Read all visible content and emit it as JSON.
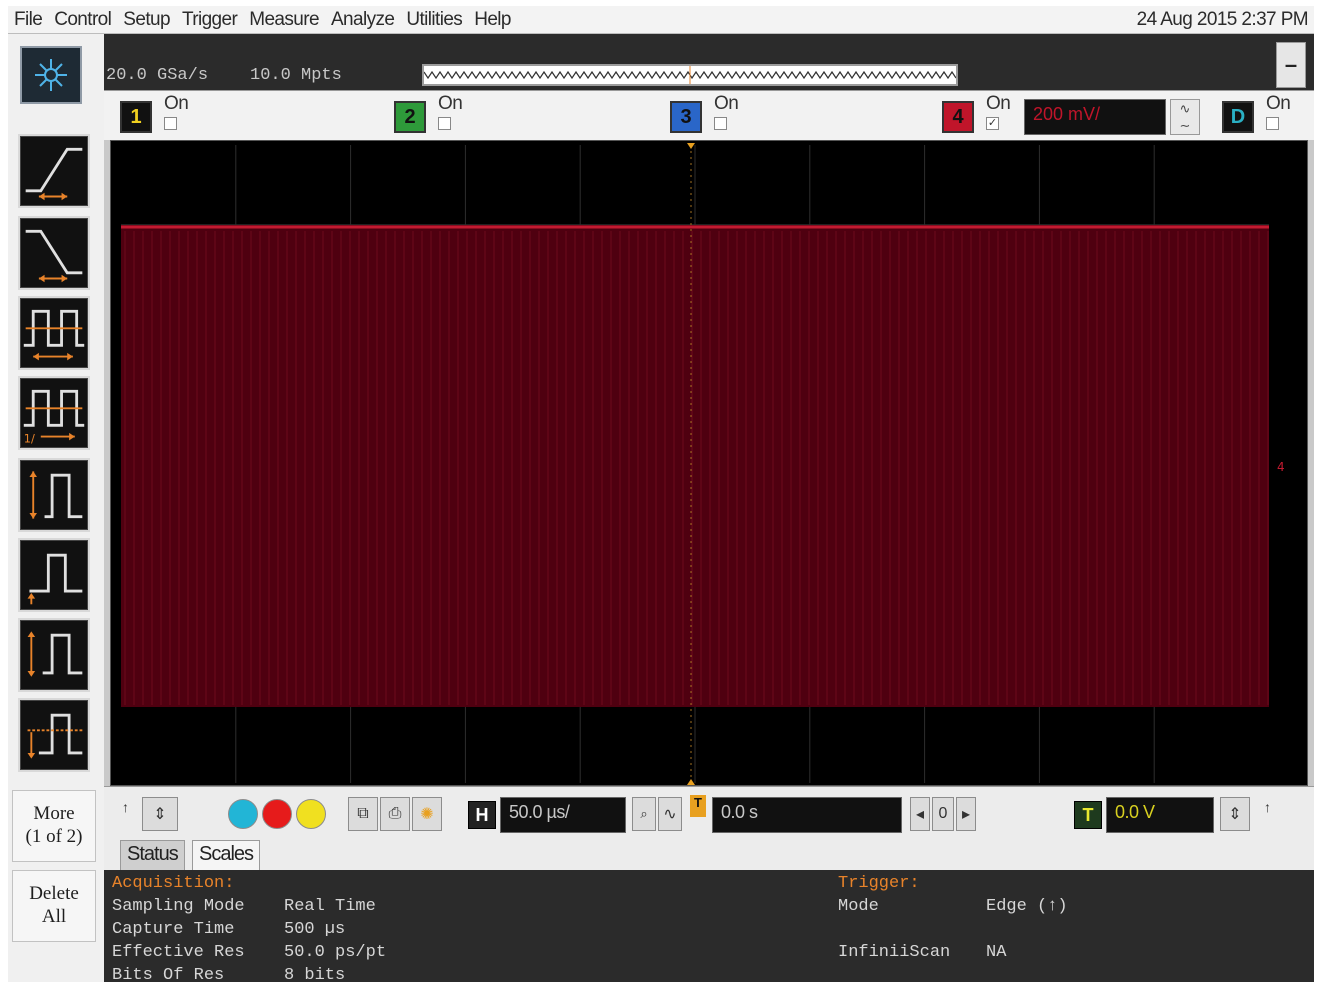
{
  "menu": {
    "items": [
      "File",
      "Control",
      "Setup",
      "Trigger",
      "Measure",
      "Analyze",
      "Utilities",
      "Help"
    ],
    "datetime": "24 Aug 2015  2:37 PM"
  },
  "acquisition_summary": {
    "sample_rate": "20.0 GSa/s",
    "memory_depth": "10.0 Mpts"
  },
  "window": {
    "minimize_label": "–"
  },
  "channels": [
    {
      "number": "1",
      "on_label": "On",
      "checked": false,
      "color": "#f0d020"
    },
    {
      "number": "2",
      "on_label": "On",
      "checked": false,
      "color": "#2e9a3a"
    },
    {
      "number": "3",
      "on_label": "On",
      "checked": false,
      "color": "#2a66c8"
    },
    {
      "number": "4",
      "on_label": "On",
      "checked": true,
      "color": "#c0152a",
      "scale": "200 mV/"
    },
    {
      "number": "D",
      "on_label": "On",
      "checked": false,
      "color": "#1a8fa0"
    }
  ],
  "waveform": {
    "channel": "4",
    "color": "#b01a2a"
  },
  "left_toolbar": {
    "tools": [
      "rise-time-icon",
      "fall-time-icon",
      "period-icon",
      "frequency-icon",
      "v-pp-icon",
      "v-top-icon",
      "v-amplitude-icon",
      "v-base-icon"
    ],
    "more_line1": "More",
    "more_line2": "(1 of 2)",
    "delete_line1": "Delete",
    "delete_line2": "All"
  },
  "controls": {
    "horizontal_label": "H",
    "horizontal_scale": "50.0 µs/",
    "horizontal_position": "0.0 s",
    "delay_reference": "0",
    "trigger_label": "T",
    "trigger_level": "0.0 V"
  },
  "tabs": [
    "Status",
    "Scales"
  ],
  "status": {
    "acquisition_heading": "Acquisition:",
    "rows": [
      {
        "label": "Sampling Mode",
        "value": "Real Time"
      },
      {
        "label": "Capture Time",
        "value": "500 µs"
      },
      {
        "label": "Effective Res",
        "value": "50.0 ps/pt"
      },
      {
        "label": "Bits Of Res",
        "value": "8 bits"
      }
    ],
    "trigger_heading": "Trigger:",
    "trigger_rows": [
      {
        "label": "Mode",
        "value": "Edge (↑)"
      },
      {
        "label": "InfiniiScan",
        "value": "NA"
      }
    ]
  }
}
